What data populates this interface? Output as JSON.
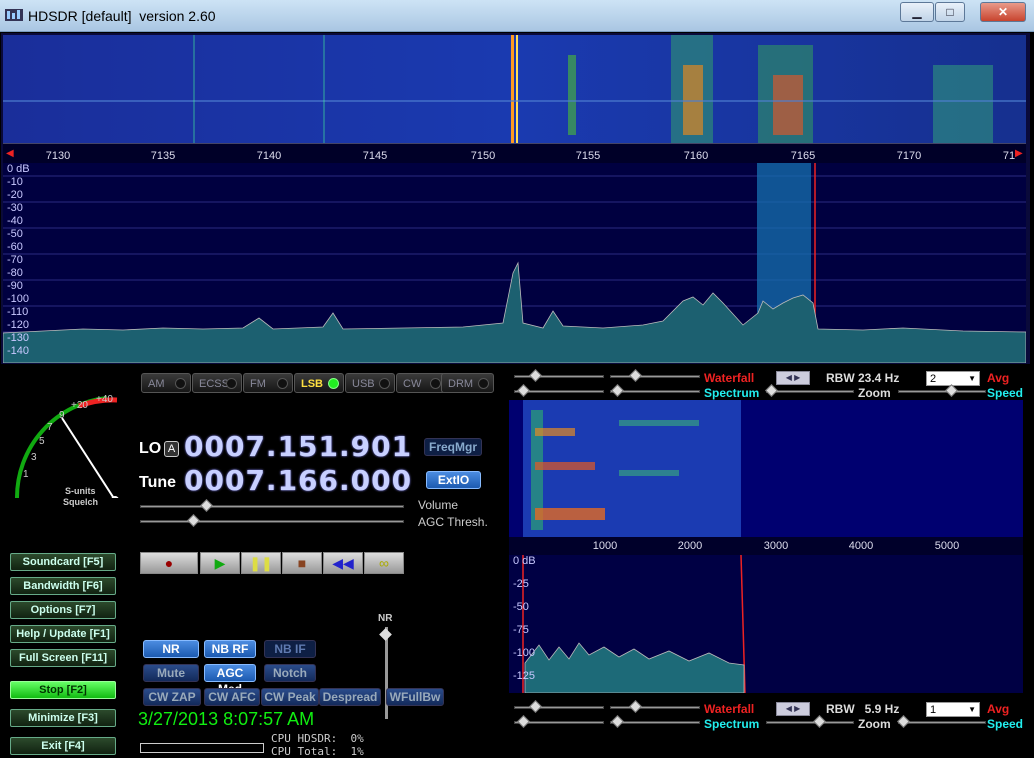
{
  "window": {
    "title": "HDSDR [default]  version 2.60",
    "minimize_icon": "minimize-icon",
    "maximize_icon": "maximize-icon",
    "close_icon": "close-icon"
  },
  "top_axis": {
    "ticks": [
      "7130",
      "7135",
      "7140",
      "7145",
      "7150",
      "7155",
      "7160",
      "7165",
      "7170",
      "71"
    ]
  },
  "top_spectrum": {
    "db_labels": [
      "0 dB",
      "-10",
      "-20",
      "-30",
      "-40",
      "-50",
      "-60",
      "-70",
      "-80",
      "-90",
      "-100",
      "-110",
      "-120",
      "-130",
      "-140"
    ]
  },
  "smeter": {
    "scale": [
      "1",
      "3",
      "5",
      "7",
      "9",
      "+20",
      "+40"
    ],
    "label": "S-units",
    "squelch": "Squelch"
  },
  "modes": [
    "AM",
    "ECSS",
    "FM",
    "LSB",
    "USB",
    "CW",
    "DRM"
  ],
  "active_mode": "LSB",
  "lo": {
    "label": "LO",
    "badge": "A",
    "value": "0007.151.901"
  },
  "tune": {
    "label": "Tune",
    "value": "0007.166.000"
  },
  "buttons": {
    "freqmgr": "FreqMgr",
    "extio": "ExtIO"
  },
  "sliders": {
    "volume": "Volume",
    "agc": "AGC Thresh."
  },
  "side": [
    "Soundcard  [F5]",
    "Bandwidth  [F6]",
    "Options  [F7]",
    "Help / Update  [F1]",
    "Full Screen  [F11]",
    "Stop  [F2]",
    "Minimize  [F3]",
    "Exit  [F4]"
  ],
  "dsp": {
    "row1": [
      "NR",
      "NB RF",
      "NB IF"
    ],
    "row2": [
      "Mute",
      "AGC Med",
      "Notch"
    ],
    "row3": [
      "CW ZAP",
      "CW AFC",
      "CW Peak",
      "Despread",
      "WFullBw"
    ],
    "nr_label": "NR"
  },
  "status": {
    "datetime": "3/27/2013 8:07:57 AM",
    "cpu_hdsdr": "CPU HDSDR:  0%",
    "cpu_total": "CPU Total:  1%"
  },
  "panel1": {
    "waterfall": "Waterfall",
    "spectrum": "Spectrum",
    "rbw": "RBW  23.4 Hz",
    "avg_value": "2",
    "avg": "Avg",
    "zoom": "Zoom",
    "speed": "Speed"
  },
  "panel2": {
    "waterfall": "Waterfall",
    "spectrum": "Spectrum",
    "rbw": "RBW   5.9 Hz",
    "avg_value": "1",
    "avg": "Avg",
    "zoom": "Zoom",
    "speed": "Speed"
  },
  "audio_axis": {
    "ticks": [
      "1000",
      "2000",
      "3000",
      "4000",
      "5000"
    ]
  },
  "audio_spectrum": {
    "db_labels": [
      "0 dB",
      "-25",
      "-50",
      "-75",
      "-100",
      "-125"
    ]
  },
  "colors": {
    "accent": "#e22",
    "cyan": "#2ee",
    "green": "#1e1"
  }
}
